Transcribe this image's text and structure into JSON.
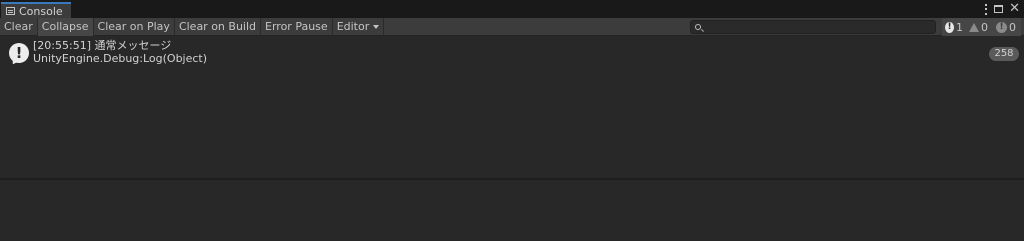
{
  "tab": {
    "title": "Console",
    "icon": "console-icon"
  },
  "window_controls": {
    "menu_icon": "kebab-icon",
    "maximize_icon": "maximize-icon",
    "close_glyph": "✕"
  },
  "toolbar": {
    "clear": "Clear",
    "collapse": "Collapse",
    "clear_on_play": "Clear on Play",
    "clear_on_build": "Clear on Build",
    "error_pause": "Error Pause",
    "editor": "Editor"
  },
  "search": {
    "value": "",
    "placeholder": ""
  },
  "counters": {
    "info": {
      "glyph": "!",
      "count": "1"
    },
    "warning": {
      "count": "0"
    },
    "error": {
      "glyph": "!",
      "count": "0"
    }
  },
  "log_entries": [
    {
      "line1": "[20:55:51] 通常メッセージ",
      "line2": "UnityEngine.Debug:Log(Object)",
      "count": "258",
      "icon": "info-icon",
      "glyph": "!"
    }
  ],
  "colors": {
    "accent": "#3a79bb",
    "background": "#282828",
    "toolbar": "#3c3c3c"
  }
}
